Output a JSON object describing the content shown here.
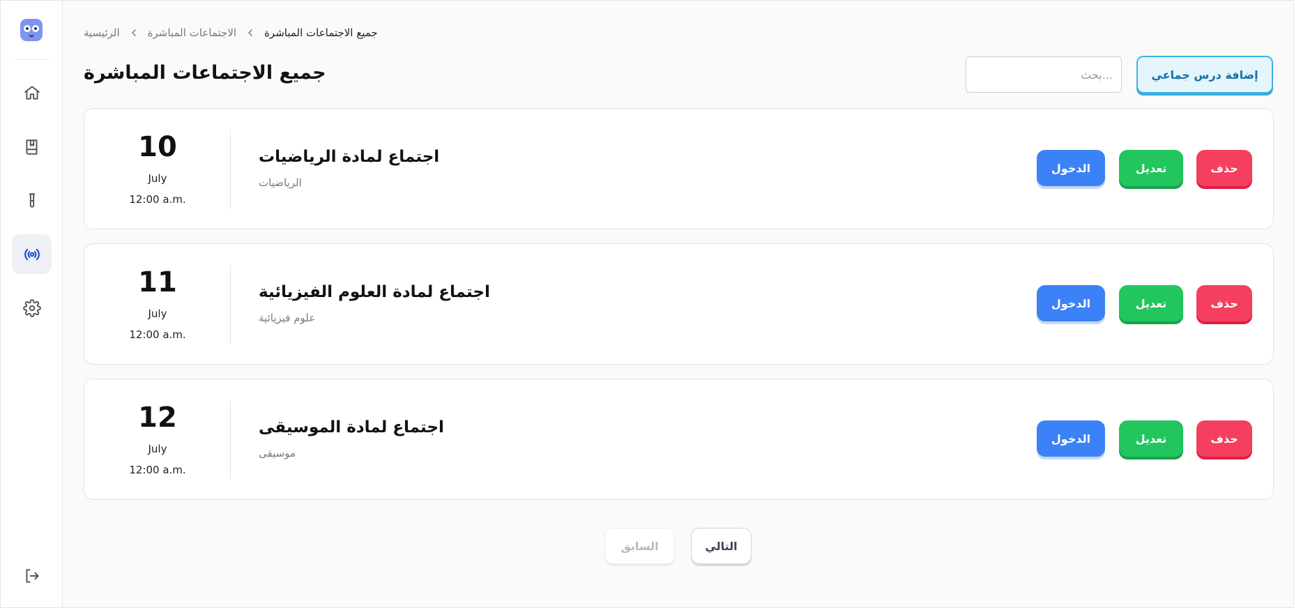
{
  "breadcrumb": {
    "home": "الرئيسية",
    "section": "الاجتماعات المباشرة",
    "current": "جميع الاجتماعات المباشرة"
  },
  "header": {
    "title": "جميع الاجتماعات المباشرة",
    "search_placeholder": "...بحث",
    "search_value": "",
    "add_button": "إضافة درس جماعي"
  },
  "sidebar": {
    "items": [
      {
        "icon": "home-icon",
        "active": false
      },
      {
        "icon": "book-icon",
        "active": false
      },
      {
        "icon": "test-tube-icon",
        "active": false
      },
      {
        "icon": "broadcast-icon",
        "active": true
      },
      {
        "icon": "gear-icon",
        "active": false
      },
      {
        "icon": "logout-icon",
        "active": false
      }
    ]
  },
  "meetings": [
    {
      "day": "10",
      "month": "July",
      "time": "12:00 a.m.",
      "title": "اجتماع لمادة الرياضيات",
      "subject": "الرياضيات"
    },
    {
      "day": "11",
      "month": "July",
      "time": "12:00 a.m.",
      "title": "اجتماع لمادة العلوم الفيزيائية",
      "subject": "علوم فيزيائية"
    },
    {
      "day": "12",
      "month": "July",
      "time": "12:00 a.m.",
      "title": "اجتماع لمادة الموسيقى",
      "subject": "موسيقى"
    }
  ],
  "actions": {
    "enter": "الدخول",
    "edit": "تعديل",
    "delete": "حذف"
  },
  "pagination": {
    "prev": "السابق",
    "next": "التالي"
  },
  "colors": {
    "enter": "#3b82f6",
    "edit": "#22c55e",
    "delete": "#f43f5e",
    "accent": "#3bb4e6",
    "active_nav": "#1d4ed8"
  }
}
